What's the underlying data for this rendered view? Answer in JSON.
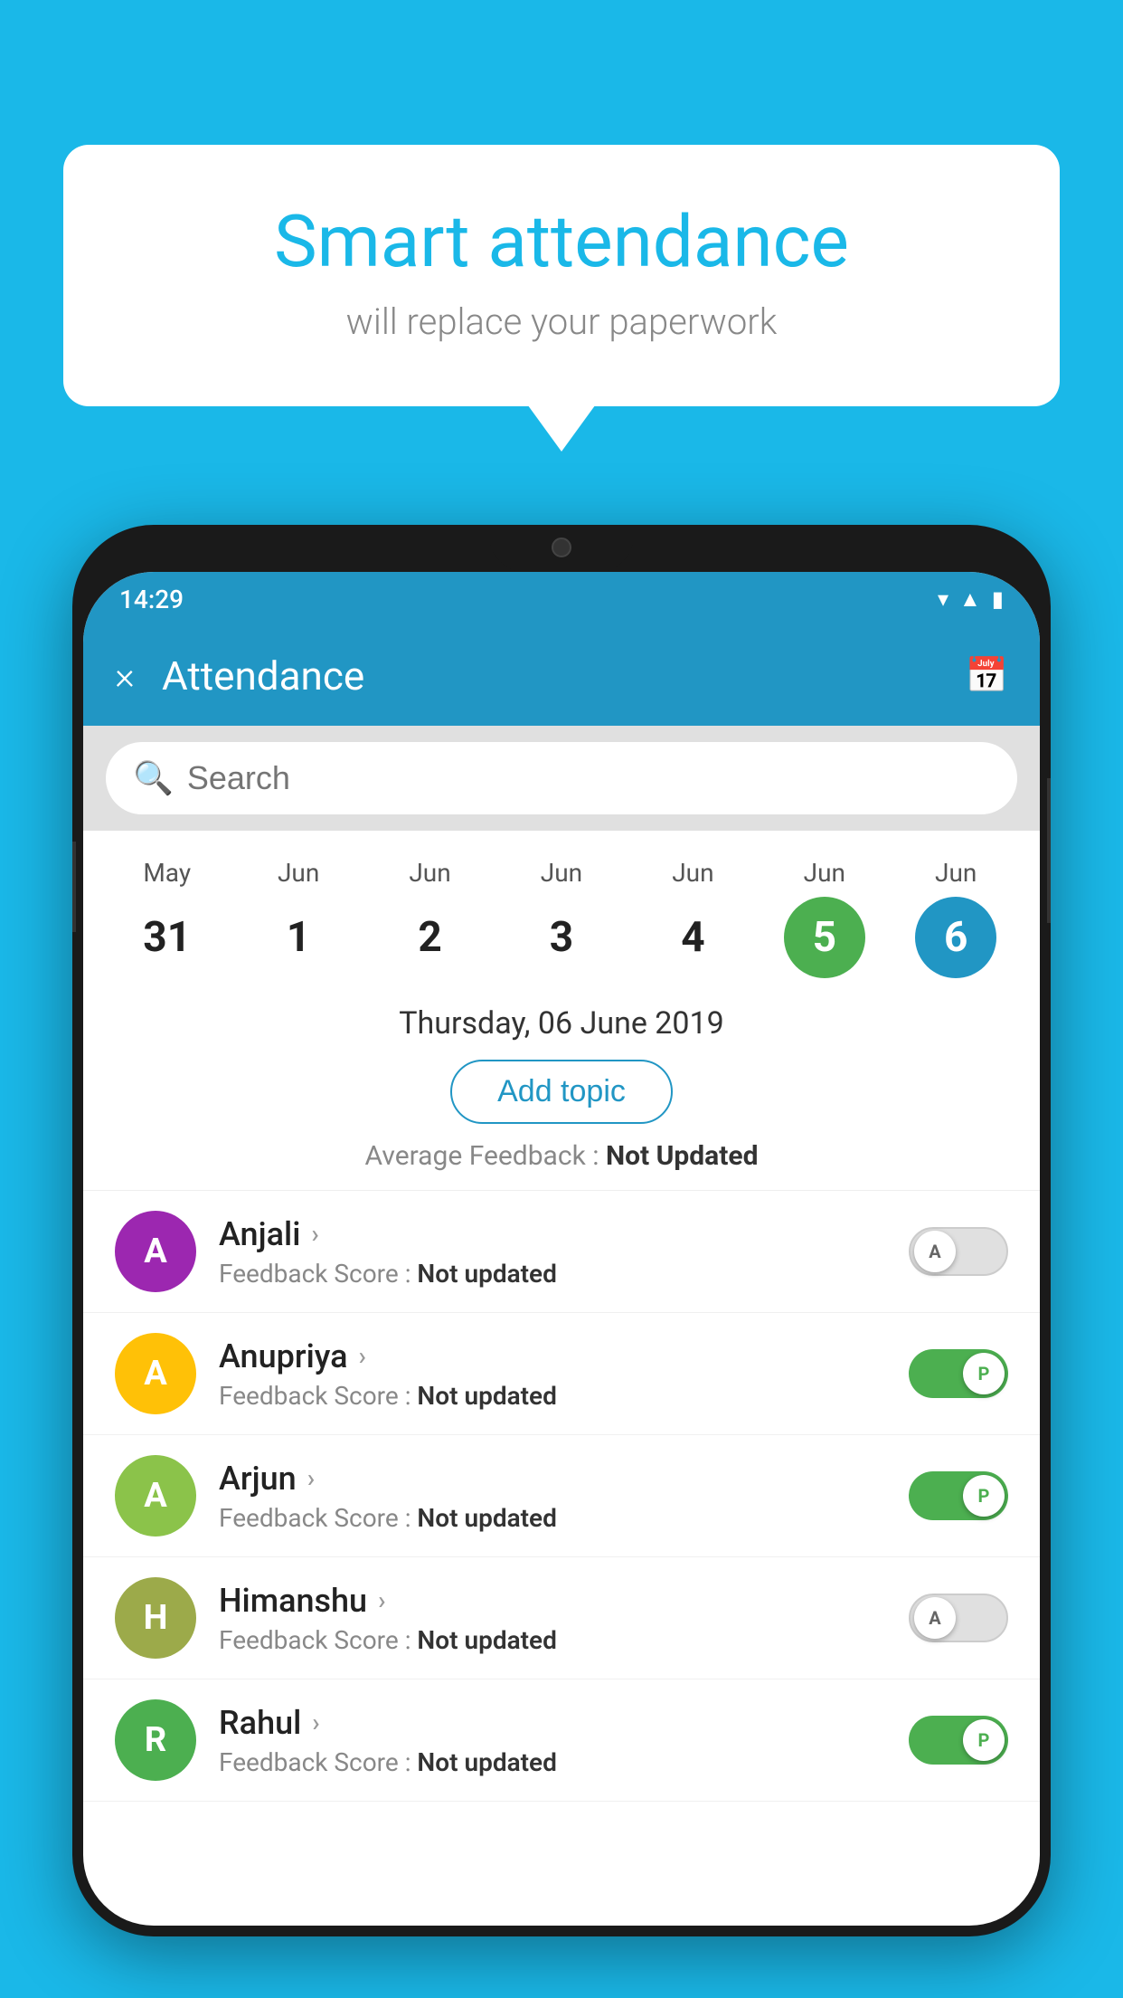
{
  "background_color": "#1ab8e8",
  "speech_bubble": {
    "title": "Smart attendance",
    "subtitle": "will replace your paperwork"
  },
  "status_bar": {
    "time": "14:29",
    "icons": [
      "wifi",
      "signal",
      "battery"
    ]
  },
  "header": {
    "title": "Attendance",
    "close_label": "×",
    "calendar_icon": "📅"
  },
  "search": {
    "placeholder": "Search"
  },
  "dates": [
    {
      "month": "May",
      "day": "31",
      "style": "normal"
    },
    {
      "month": "Jun",
      "day": "1",
      "style": "normal"
    },
    {
      "month": "Jun",
      "day": "2",
      "style": "normal"
    },
    {
      "month": "Jun",
      "day": "3",
      "style": "normal"
    },
    {
      "month": "Jun",
      "day": "4",
      "style": "normal"
    },
    {
      "month": "Jun",
      "day": "5",
      "style": "green"
    },
    {
      "month": "Jun",
      "day": "6",
      "style": "blue"
    }
  ],
  "selected_date": "Thursday, 06 June 2019",
  "add_topic_label": "Add topic",
  "average_feedback_label": "Average Feedback : ",
  "average_feedback_value": "Not Updated",
  "students": [
    {
      "name": "Anjali",
      "avatar_letter": "A",
      "avatar_color": "purple",
      "feedback_label": "Feedback Score : ",
      "feedback_value": "Not updated",
      "toggle": "off",
      "toggle_letter": "A"
    },
    {
      "name": "Anupriya",
      "avatar_letter": "A",
      "avatar_color": "yellow",
      "feedback_label": "Feedback Score : ",
      "feedback_value": "Not updated",
      "toggle": "on",
      "toggle_letter": "P"
    },
    {
      "name": "Arjun",
      "avatar_letter": "A",
      "avatar_color": "light-green",
      "feedback_label": "Feedback Score : ",
      "feedback_value": "Not updated",
      "toggle": "on",
      "toggle_letter": "P"
    },
    {
      "name": "Himanshu",
      "avatar_letter": "H",
      "avatar_color": "olive",
      "feedback_label": "Feedback Score : ",
      "feedback_value": "Not updated",
      "toggle": "off",
      "toggle_letter": "A"
    },
    {
      "name": "Rahul",
      "avatar_letter": "R",
      "avatar_color": "teal",
      "feedback_label": "Feedback Score : ",
      "feedback_value": "Not updated",
      "toggle": "on",
      "toggle_letter": "P"
    }
  ]
}
